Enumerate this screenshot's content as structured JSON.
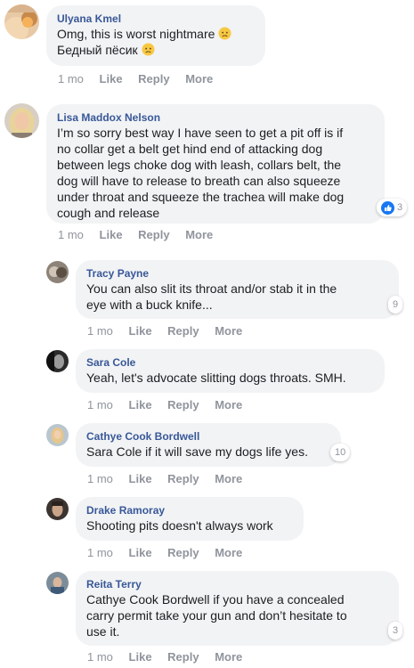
{
  "colors": {
    "author": "#385898",
    "bubble": "#f2f3f5",
    "meta": "#90949c",
    "like_blue": "#1877f2"
  },
  "comments": [
    {
      "author": "Ulyana Kmel",
      "lines": [
        "Omg, this is worst nightmare",
        "Бедный пёсик"
      ],
      "emoji": "sad-face-icon",
      "time": "1 mo",
      "like": "Like",
      "reply": "Reply",
      "more": "More"
    },
    {
      "author": "Lisa Maddox Nelson",
      "lines": [
        "I’m so sorry best way I have seen to get a pit off is if",
        "no collar get a belt get hind end of attacking dog",
        "between legs choke dog with leash, collars belt, the",
        "dog will have to release to breath can also squeeze",
        "under throat and squeeze the trachea will make dog",
        "cough and release"
      ],
      "reaction_count": "3",
      "reaction_icon": "like-icon",
      "time": "1 mo",
      "like": "Like",
      "reply": "Reply",
      "more": "More"
    },
    {
      "author": "Tracy Payne",
      "lines": [
        "You can also slit its throat and/or stab it in the",
        "eye with a buck knife..."
      ],
      "reaction_count": "9",
      "time": "1 mo",
      "like": "Like",
      "reply": "Reply",
      "more": "More"
    },
    {
      "author": "Sara Cole",
      "lines": [
        "Yeah, let's advocate slitting dogs throats. SMH."
      ],
      "time": "1 mo",
      "like": "Like",
      "reply": "Reply",
      "more": "More"
    },
    {
      "author": "Cathye Cook Bordwell",
      "lines": [
        "Sara Cole if it will save my dogs life yes."
      ],
      "reaction_count": "10",
      "time": "1 mo",
      "like": "Like",
      "reply": "Reply",
      "more": "More"
    },
    {
      "author": "Drake Ramoray",
      "lines": [
        "Shooting pits doesn't always work"
      ],
      "time": "1 mo",
      "like": "Like",
      "reply": "Reply",
      "more": "More"
    },
    {
      "author": "Reita Terry",
      "lines": [
        "Cathye Cook Bordwell if you have a concealed",
        "carry permit take your gun and don’t hesitate to",
        "use it."
      ],
      "reaction_count": "3",
      "time": "1 mo",
      "like": "Like",
      "reply": "Reply",
      "more": "More"
    }
  ]
}
